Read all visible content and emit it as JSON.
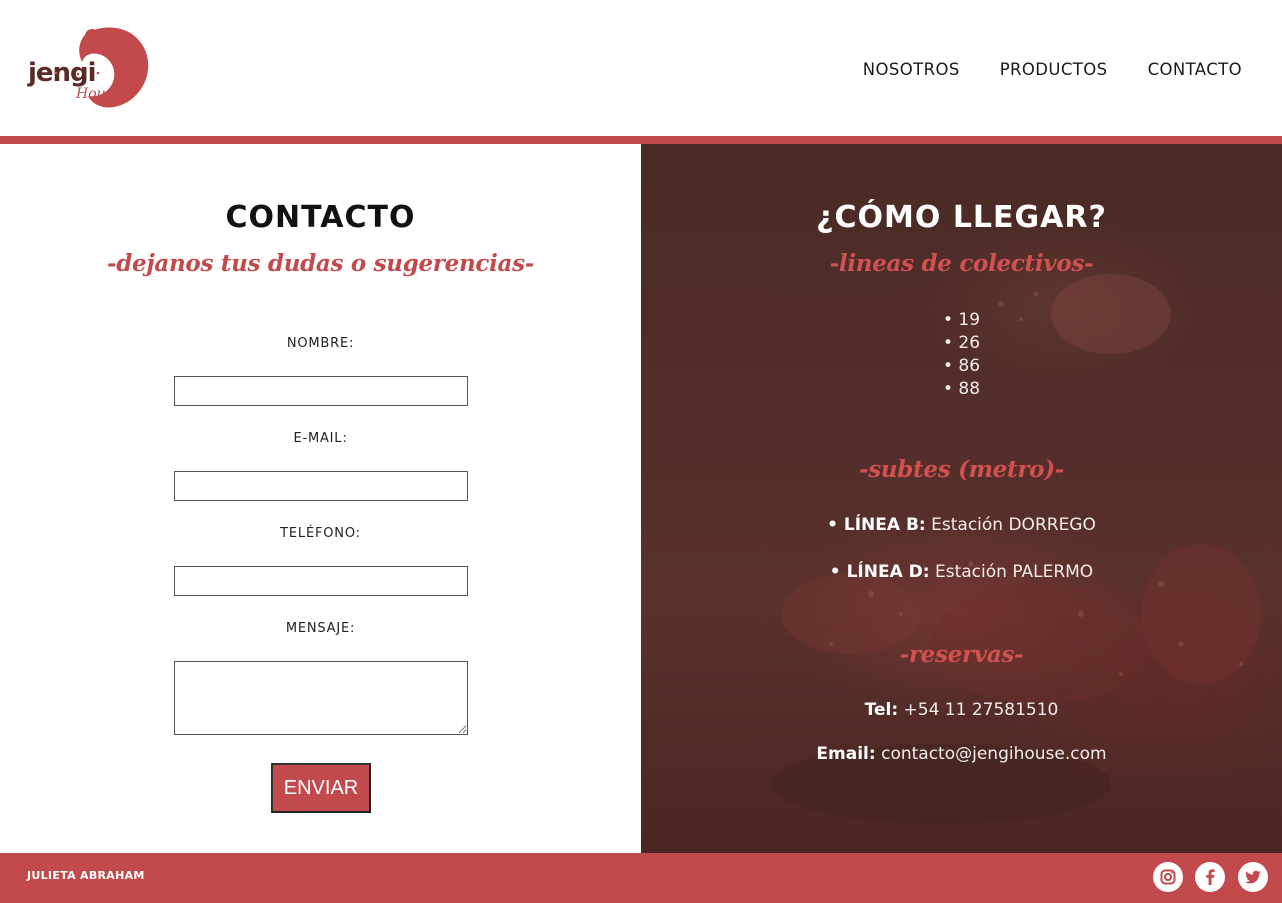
{
  "brand": {
    "logo_text": "jengi",
    "logo_subtext": "House",
    "accent_color": "#c24a4c",
    "logo_dark_color": "#5a2a24"
  },
  "nav": {
    "items": [
      "NOSOTROS",
      "PRODUCTOS",
      "CONTACTO"
    ]
  },
  "contact": {
    "title": "CONTACTO",
    "subtitle": "-dejanos tus dudas o sugerencias-",
    "fields": {
      "name_label": "NOMBRE:",
      "email_label": "E-MAIL:",
      "phone_label": "TELÉFONO:",
      "message_label": "MENSAJE:"
    },
    "submit_label": "ENVIAR"
  },
  "directions": {
    "title": "¿CÓMO LLEGAR?",
    "bus_heading": "-lineas de colectivos-",
    "bus_lines": [
      "• 19",
      "• 26",
      "• 86",
      "• 88"
    ],
    "subte_heading": "-subtes (metro)-",
    "subte": [
      {
        "line": "• LÍNEA B:",
        "station": "Estación DORREGO"
      },
      {
        "line": "• LÍNEA D:",
        "station": "Estación PALERMO"
      }
    ],
    "reservas_heading": "-reservas-",
    "tel_label": "Tel:",
    "tel_value": "+54 11 27581510",
    "email_label": "Email:",
    "email_value": "contacto@jengihouse.com"
  },
  "footer": {
    "author": "JULIETA ABRAHAM",
    "social_icons": [
      "instagram-icon",
      "facebook-icon",
      "twitter-icon"
    ]
  }
}
